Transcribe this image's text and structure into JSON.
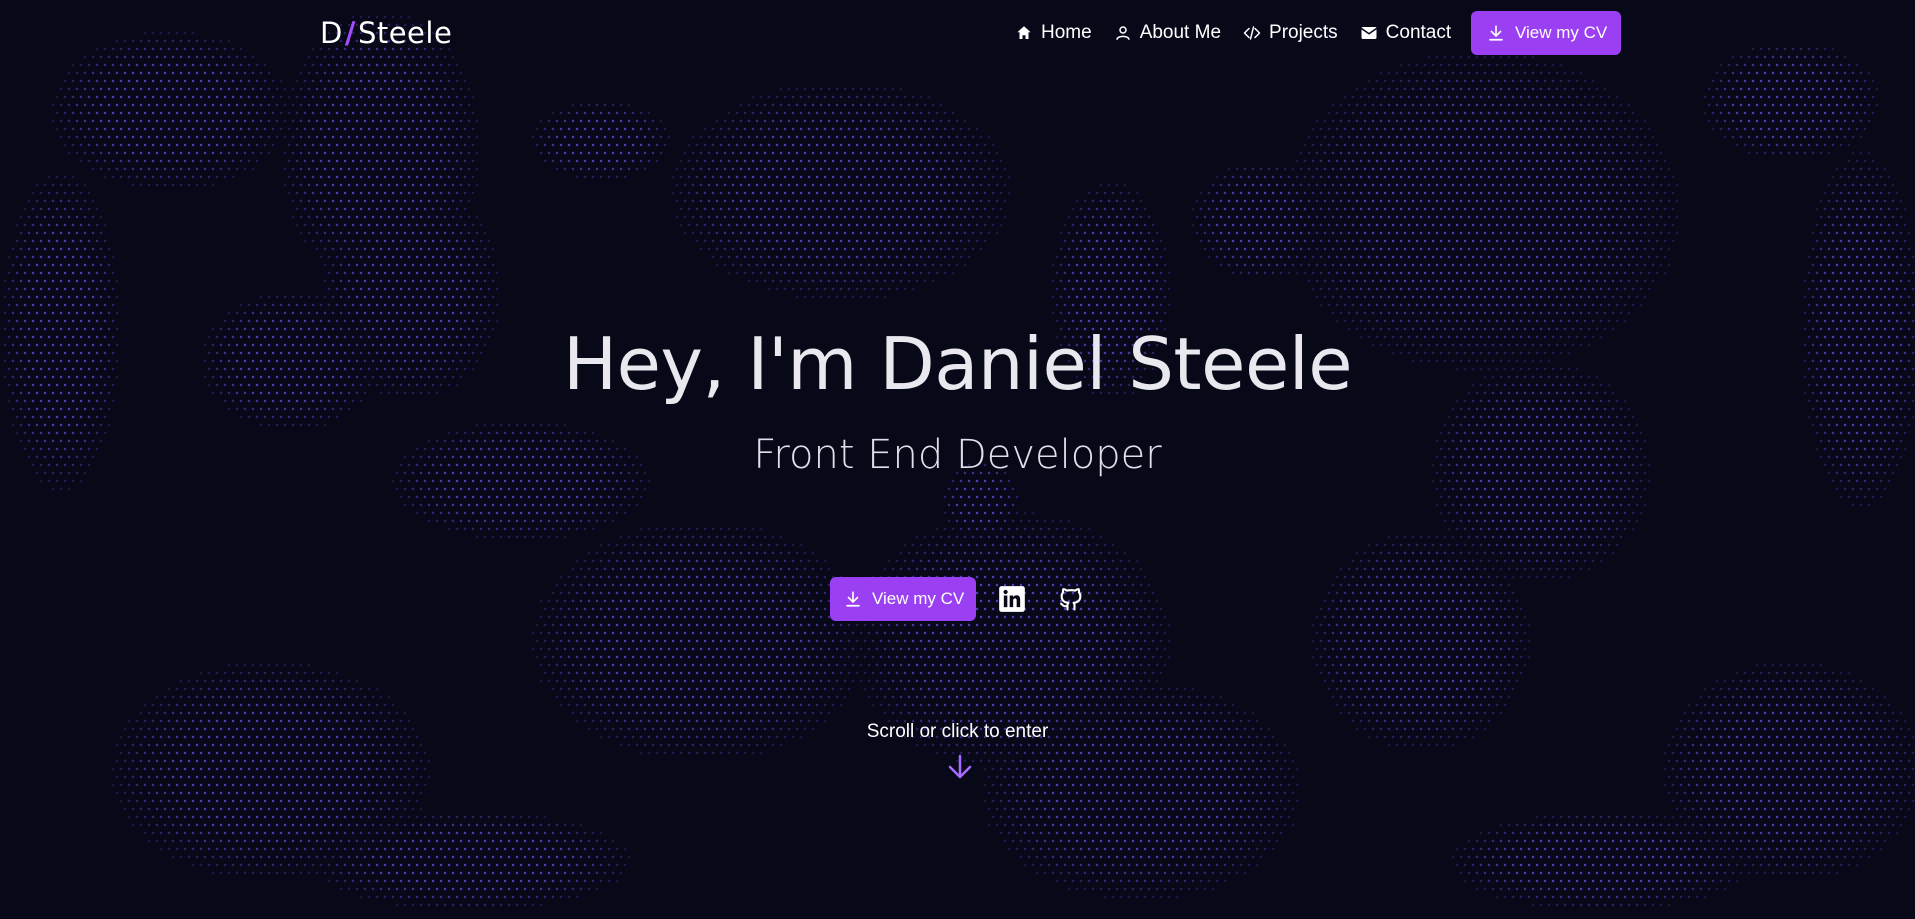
{
  "colors": {
    "background": "#070818",
    "accent": "#9b3ff2",
    "dots": "#7c52ff",
    "text": "#ffffff"
  },
  "logo": {
    "initial": "D",
    "slash": "/",
    "name": "Steele"
  },
  "nav": {
    "items": [
      {
        "label": "Home",
        "icon": "home-icon"
      },
      {
        "label": "About Me",
        "icon": "user-icon"
      },
      {
        "label": "Projects",
        "icon": "code-icon"
      },
      {
        "label": "Contact",
        "icon": "mail-icon"
      }
    ],
    "cv_label": "View my CV"
  },
  "hero": {
    "headline": "Hey, I'm Daniel Steele",
    "subtitle": "Front End Developer",
    "cv_label": "View my CV",
    "social": [
      {
        "icon": "linkedin-icon"
      },
      {
        "icon": "github-icon"
      }
    ]
  },
  "scroll": {
    "label": "Scroll or click to enter",
    "icon": "arrow-down-icon"
  }
}
